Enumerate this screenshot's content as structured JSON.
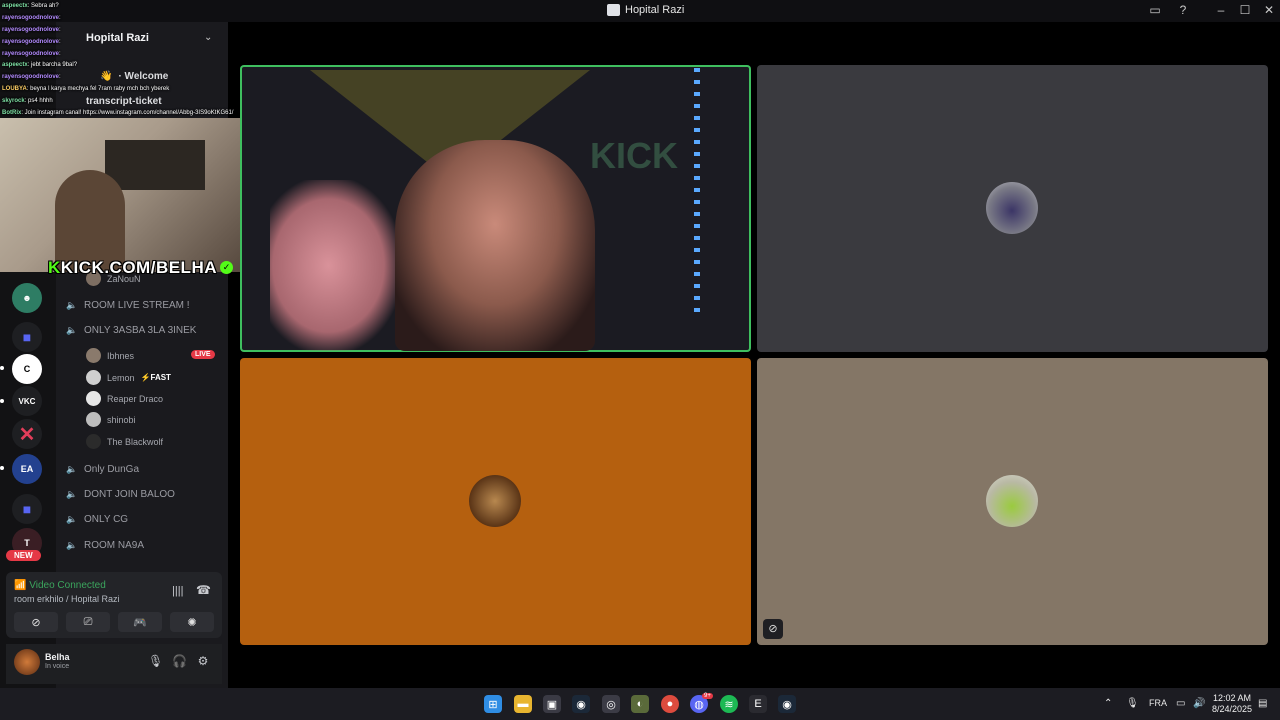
{
  "window": {
    "title": "Hopital Razi"
  },
  "server": {
    "name": "Hopital Razi"
  },
  "channels_top": {
    "welcome": "· Welcome",
    "transcript": "transcript-ticket"
  },
  "voice_channels": [
    {
      "label": "ROOM LIVE STREAM !"
    },
    {
      "label": "ONLY 3ASBA 3LA 3INEK"
    },
    {
      "label": "Only DunGa"
    },
    {
      "label": "DONT JOIN BALOO"
    },
    {
      "label": "ONLY CG"
    },
    {
      "label": "ROOM NA9A"
    }
  ],
  "voice_users": [
    {
      "name": "Ibhnes",
      "badge": "LIVE"
    },
    {
      "name": "Lemon",
      "tag": "⚡FAST"
    },
    {
      "name": "Reaper Draco"
    },
    {
      "name": "shinobi"
    },
    {
      "name": "The Blackwolf"
    }
  ],
  "partial_user": "ZaNouN",
  "server_badge": "NEW",
  "voice_status": {
    "status": "Video Connected",
    "room": "room erkhilo / Hopital Razi"
  },
  "user": {
    "name": "Belha",
    "status": "In voice"
  },
  "stream_overlay": {
    "kick_prefix": "K",
    "kick_text": "KICK.COM/BELHA"
  },
  "chat": [
    {
      "user": "aspeectx",
      "msg": ": Sebra ah?"
    },
    {
      "user": "rayensogoodnolove",
      "msg": ":"
    },
    {
      "user": "rayensogoodnolove",
      "msg": ":"
    },
    {
      "user": "rayensogoodnolove",
      "msg": ":"
    },
    {
      "user": "rayensogoodnolove",
      "msg": ":"
    },
    {
      "user": "aspeectx",
      "msg": ": jebt barcha 9bal?"
    },
    {
      "user": "rayensogoodnolove",
      "msg": ":"
    },
    {
      "user": "LOUBYA",
      "msg": ": beyna l karya mechya fel 7ram raby mch bch yberek"
    },
    {
      "user": "skyrock",
      "msg": ": ps4 hhhh"
    },
    {
      "user": "BotRix",
      "msg": ": Join instagram canal! https://www.instagram.com/channel/Abbg-3IS9oKtKG61/"
    }
  ],
  "taskbar": {
    "lang": "FRA",
    "time": "12:02 AM",
    "date": "8/24/2025",
    "notif_badge": "9+"
  },
  "colors": {
    "accent_green": "#3fbf5f",
    "kick_green": "#53fc18",
    "tile_orange": "#b5600f",
    "tile_taupe": "#847666",
    "tile_gray": "#3a3a3f",
    "live_red": "#e53946"
  },
  "icons": [
    "app-icon",
    "chevron-down-icon",
    "speaker-icon",
    "signal-icon",
    "soundboard-icon",
    "disconnect-icon",
    "camera-off-icon",
    "screen-share-icon",
    "activity-icon",
    "sparkle-icon",
    "mic-icon",
    "headphones-icon",
    "gear-icon",
    "windows-start-icon",
    "folder-icon",
    "store-icon",
    "steam-icon",
    "discord-icon",
    "chrome-icon",
    "spotify-icon",
    "wifi-icon",
    "volume-icon"
  ]
}
